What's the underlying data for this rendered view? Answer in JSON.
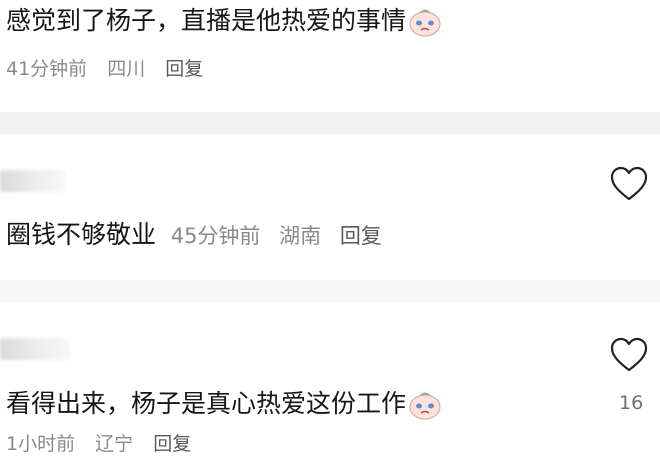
{
  "comments": [
    {
      "text": "感觉到了杨子，直播是他热爱的事情",
      "emoji_icon": "crying-face-icon",
      "time": "41分钟前",
      "location": "四川",
      "reply_label": "回复"
    },
    {
      "text": "圈钱不够敬业",
      "time": "45分钟前",
      "location": "湖南",
      "reply_label": "回复"
    },
    {
      "text": "看得出来，杨子是真心热爱这份工作",
      "emoji_icon": "crying-face-icon",
      "time": "1小时前",
      "location": "辽宁",
      "reply_label": "回复",
      "like_count": "16"
    }
  ],
  "colors": {
    "meta": "#8a8a8a",
    "divider": "#f2f2f2",
    "heart_stroke": "#222222"
  }
}
